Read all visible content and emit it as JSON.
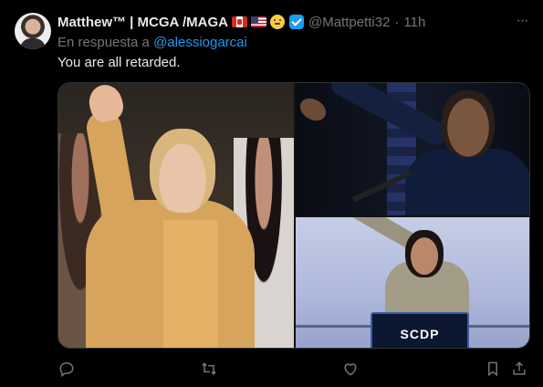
{
  "tweet": {
    "author_name": "Matthew™ | MCGA /MAGA",
    "handle": "@Mattpetti32",
    "separator": "·",
    "time": "11h",
    "reply_prefix": "En respuesta a ",
    "reply_to": "@alessiogarcai",
    "text": "You are all retarded.",
    "more_glyph": "···"
  },
  "media": {
    "podium_label": "SCDP"
  },
  "icons": [
    "canada-flag-icon",
    "us-flag-icon",
    "face-emoji-icon",
    "verified-badge-icon",
    "more-icon",
    "reply-icon",
    "retweet-icon",
    "like-icon",
    "bookmark-icon",
    "share-icon"
  ],
  "colors": {
    "background": "#000000",
    "text": "#e7e9ea",
    "muted": "#71767b",
    "accent": "#1d9bf0",
    "border": "#2f3336"
  }
}
